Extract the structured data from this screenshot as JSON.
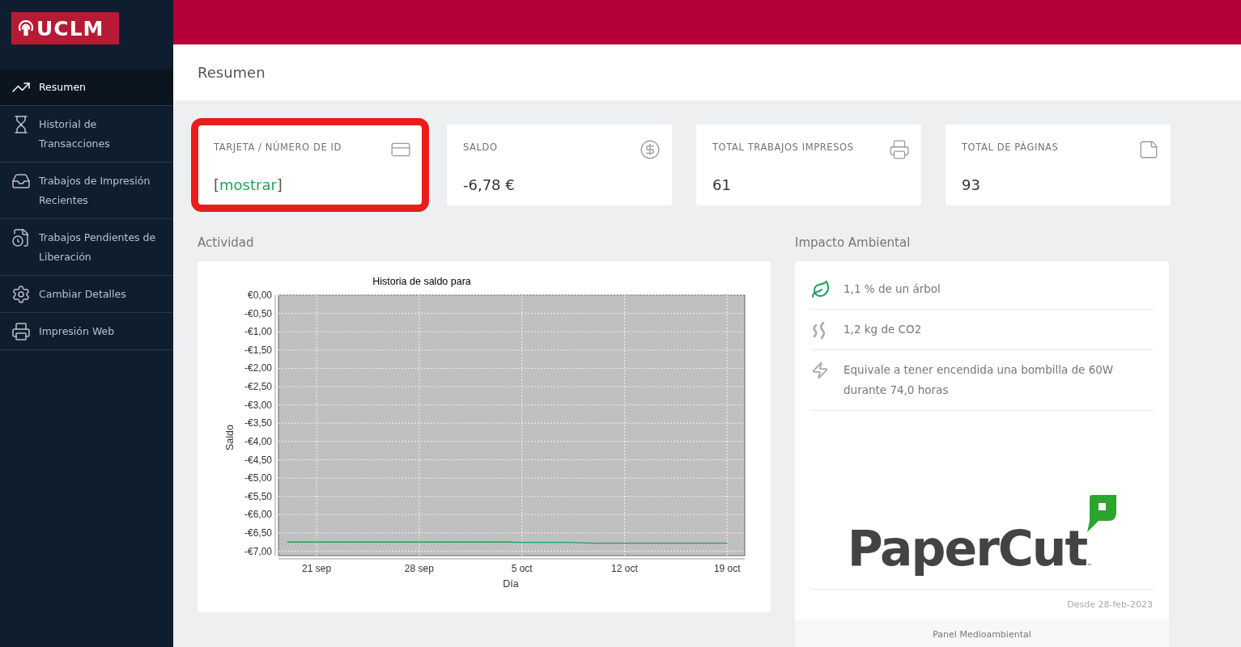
{
  "logo": {
    "text": "UCLM"
  },
  "sidebar": {
    "items": [
      {
        "kind": "chart",
        "label": "Resumen",
        "selected": true
      },
      {
        "kind": "hourglass",
        "label": "Historial de Transacciones",
        "selected": false
      },
      {
        "kind": "tray",
        "label": "Trabajos de Impresión Recientes",
        "selected": false
      },
      {
        "kind": "pending",
        "label": "Trabajos Pendientes de Liberación",
        "selected": false
      },
      {
        "kind": "gear",
        "label": "Cambiar Detalles",
        "selected": false
      },
      {
        "kind": "web",
        "label": "Impresión Web",
        "selected": false
      }
    ]
  },
  "page_title": "Resumen",
  "cards": [
    {
      "kind": "card",
      "label": "TARJETA / NÚMERO DE ID",
      "value": "mostrar",
      "bracket_open": "[",
      "bracket_close": "]",
      "highlighted": true
    },
    {
      "kind": "money",
      "label": "SALDO",
      "value": "-6,78 €",
      "highlighted": false
    },
    {
      "kind": "printer",
      "label": "TOTAL TRABAJOS IMPRESOS",
      "value": "61",
      "highlighted": false
    },
    {
      "kind": "page",
      "label": "TOTAL DE PÁGINAS",
      "value": "93",
      "highlighted": false
    }
  ],
  "activity": {
    "heading": "Actividad",
    "chart_data": {
      "type": "line",
      "title": "Historia de saldo para",
      "xlabel": "Día",
      "ylabel": "Saldo",
      "categories": [
        null,
        null,
        "21 sep",
        null,
        null,
        null,
        null,
        null,
        null,
        "28 sep",
        null,
        null,
        null,
        null,
        null,
        null,
        "5 oct",
        null,
        null,
        null,
        null,
        null,
        null,
        "12 oct",
        null,
        null,
        null,
        null,
        null,
        null,
        "19 oct"
      ],
      "series": [
        {
          "color": "#1aa35a",
          "values": [
            -6.75,
            -6.75,
            -6.75,
            -6.75,
            -6.75,
            -6.75,
            -6.75,
            -6.75,
            -6.75,
            -6.75,
            -6.75,
            -6.75,
            -6.75,
            -6.75,
            -6.75,
            -6.75,
            -6.76,
            -6.76,
            -6.76,
            -6.76,
            -6.77,
            -6.78,
            -6.78,
            -6.78,
            -6.78,
            -6.78,
            -6.78,
            -6.78,
            -6.78,
            -6.78,
            -6.78
          ]
        }
      ],
      "ylim": [
        -7.12,
        0
      ],
      "grid": true,
      "yticks": [
        {
          "value": 0,
          "label": "€0,00"
        },
        {
          "value": -0.5,
          "label": "-€0,50"
        },
        {
          "value": -1,
          "label": "-€1,00"
        },
        {
          "value": -1.5,
          "label": "-€1,50"
        },
        {
          "value": -2,
          "label": "-€2,00"
        },
        {
          "value": -2.5,
          "label": "-€2,50"
        },
        {
          "value": -3,
          "label": "-€3,00"
        },
        {
          "value": -3.5,
          "label": "-€3,50"
        },
        {
          "value": -4,
          "label": "-€4,00"
        },
        {
          "value": -4.5,
          "label": "-€4,50"
        },
        {
          "value": -5,
          "label": "-€5,00"
        },
        {
          "value": -5.5,
          "label": "-€5,50"
        },
        {
          "value": -6,
          "label": "-€6,00"
        },
        {
          "value": -6.5,
          "label": "-€6,50"
        },
        {
          "value": -7,
          "label": "-€7,00"
        }
      ]
    }
  },
  "environment": {
    "heading": "Impacto Ambiental",
    "items": [
      {
        "kind": "leaf",
        "text": "1,1 % de un árbol"
      },
      {
        "kind": "smoke",
        "text": "1,2 kg de CO2"
      },
      {
        "kind": "bolt",
        "text": "Equivale a tener encendida una bombilla de 60W durante 74,0 horas"
      }
    ],
    "brand": "PaperCut",
    "trademark": "™",
    "since": "Desde 28-feb-2023",
    "footer_link": "Panel Medioambiental"
  }
}
